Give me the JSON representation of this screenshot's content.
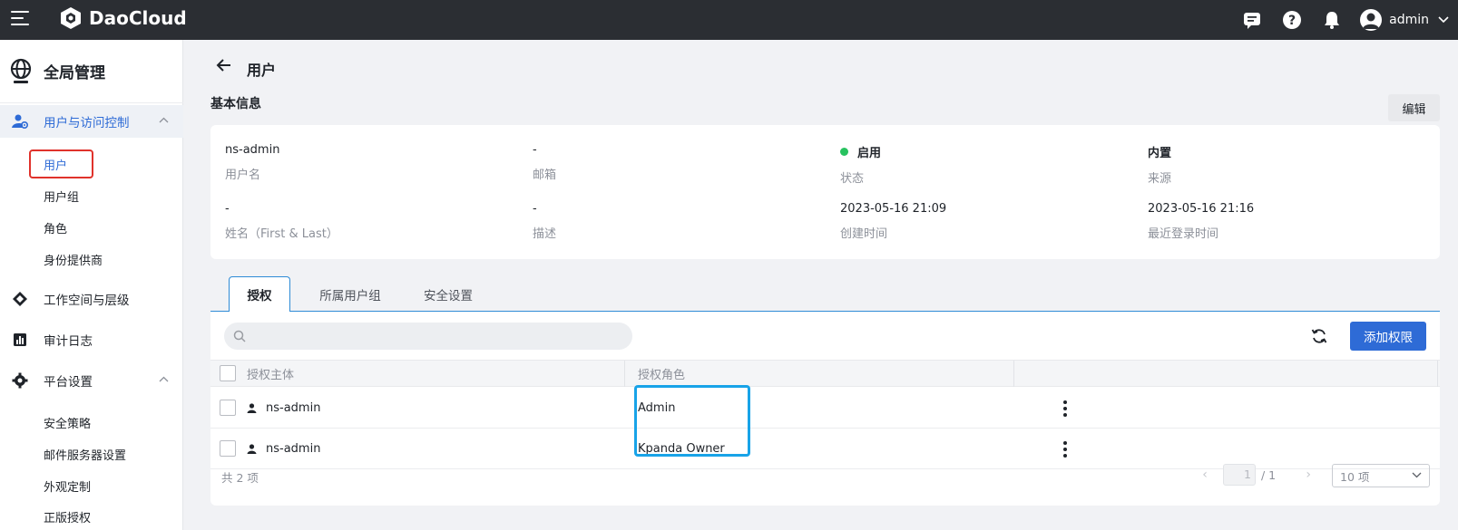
{
  "app": {
    "brand": "DaoCloud"
  },
  "topbar": {
    "username": "admin"
  },
  "sidebar": {
    "title": "全局管理",
    "groups": [
      {
        "label": "用户与访问控制",
        "expanded": true,
        "items": [
          "用户",
          "用户组",
          "角色",
          "身份提供商"
        ]
      },
      {
        "label": "工作空间与层级"
      },
      {
        "label": "审计日志"
      },
      {
        "label": "平台设置",
        "expanded": true,
        "items": [
          "安全策略",
          "邮件服务器设置",
          "外观定制",
          "正版授权"
        ]
      }
    ]
  },
  "page": {
    "title": "用户",
    "section_title": "基本信息",
    "edit_label": "编辑"
  },
  "info": [
    {
      "value": "ns-admin",
      "key": "用户名"
    },
    {
      "value": "-",
      "key": "邮箱"
    },
    {
      "value": "启用",
      "key": "状态"
    },
    {
      "value": "内置",
      "key": "来源"
    },
    {
      "value": "-",
      "key": "姓名（First & Last）"
    },
    {
      "value": "-",
      "key": "描述"
    },
    {
      "value": "2023-05-16 21:09",
      "key": "创建时间"
    },
    {
      "value": "2023-05-16 21:16",
      "key": "最近登录时间"
    }
  ],
  "tabs": [
    "授权",
    "所属用户组",
    "安全设置"
  ],
  "toolbar": {
    "search_placeholder": "",
    "add_label": "添加权限"
  },
  "table": {
    "columns": [
      "授权主体",
      "授权角色"
    ],
    "rows": [
      {
        "subject": "ns-admin",
        "role": "Admin"
      },
      {
        "subject": "ns-admin",
        "role": "Kpanda Owner"
      }
    ]
  },
  "pagination": {
    "total_text": "共 2 项",
    "current": "1",
    "pages": "/ 1",
    "page_size": "10 项"
  },
  "colors": {
    "accent": "#2e6bd6",
    "status_enabled": "#27c25f",
    "highlight_red": "#e0322b",
    "highlight_blue": "#18a3e8"
  }
}
